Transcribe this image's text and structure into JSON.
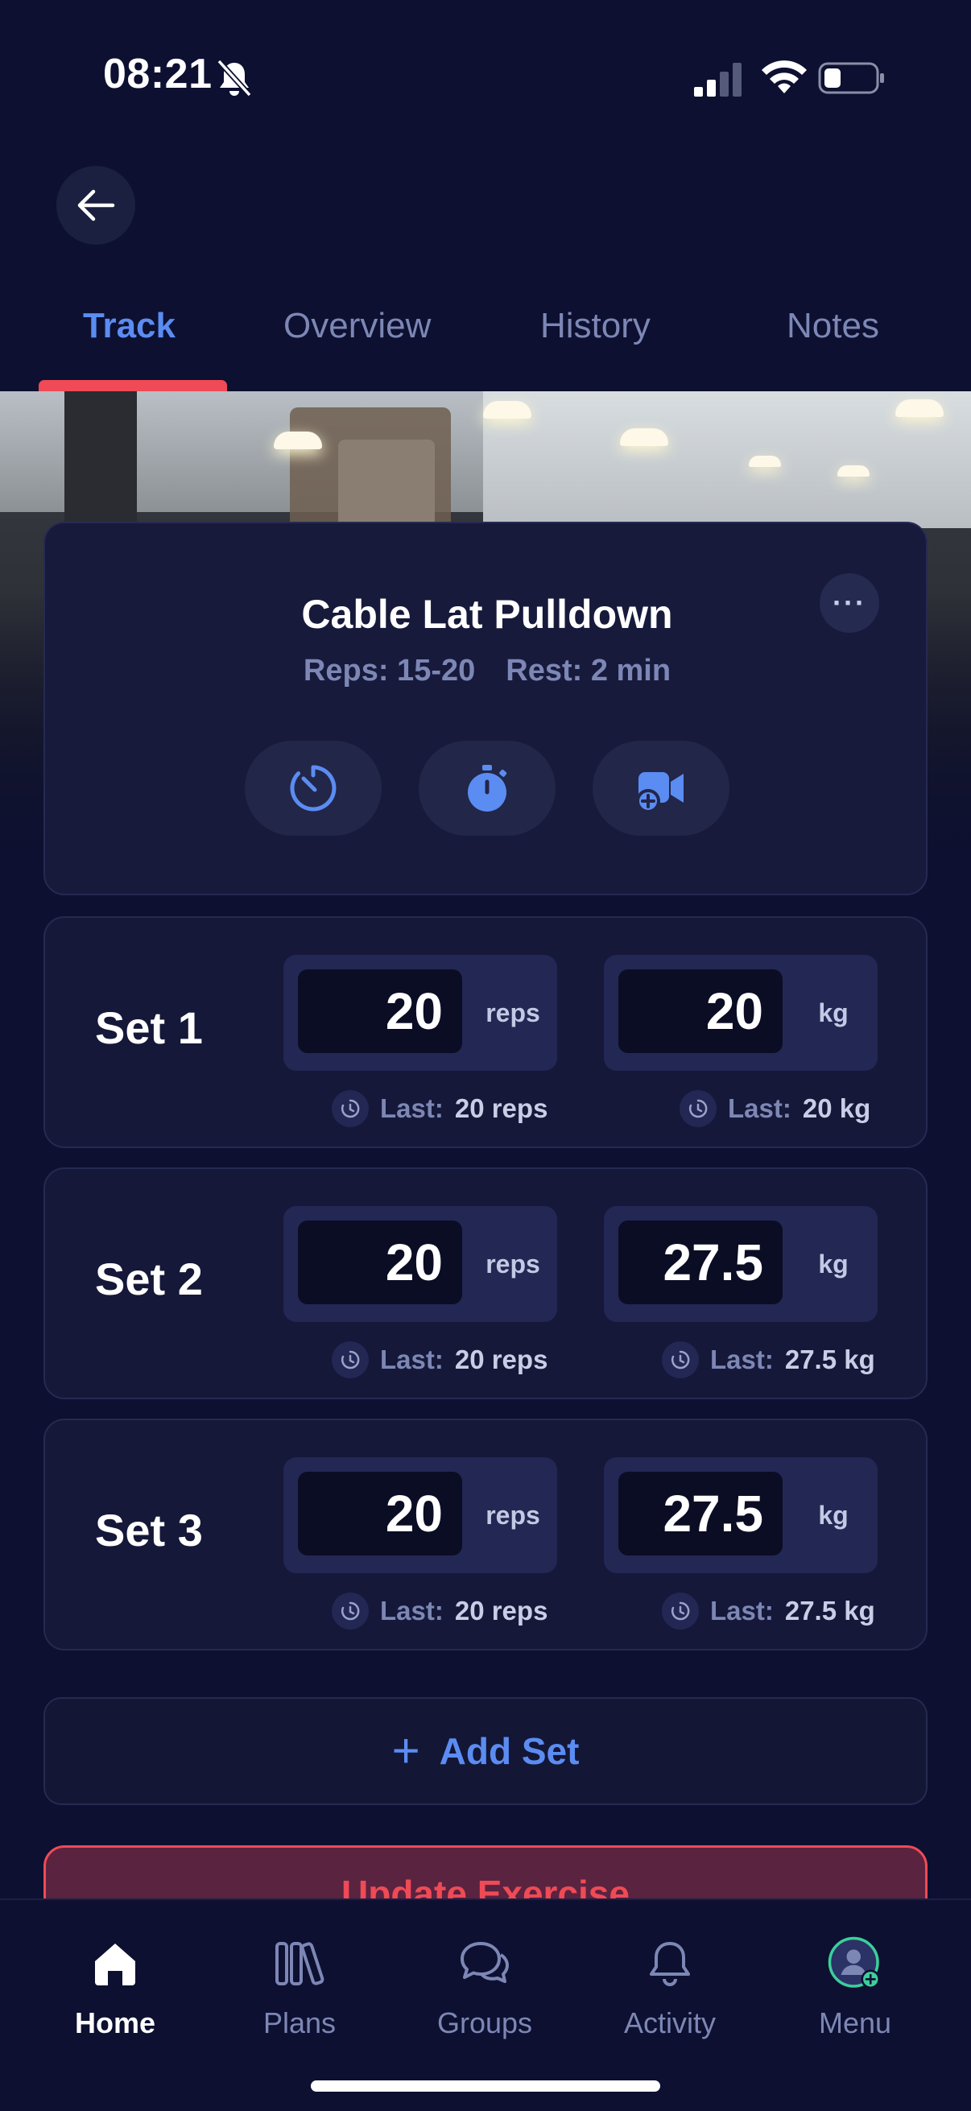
{
  "status_bar": {
    "time": "08:21"
  },
  "tabs": [
    {
      "label": "Track",
      "active": true
    },
    {
      "label": "Overview",
      "active": false
    },
    {
      "label": "History",
      "active": false
    },
    {
      "label": "Notes",
      "active": false
    }
  ],
  "exercise": {
    "title": "Cable Lat Pulldown",
    "reps": "Reps: 15-20",
    "rest": "Rest: 2 min",
    "actions": [
      "timer-icon",
      "stopwatch-icon",
      "add-video-icon"
    ]
  },
  "sets": [
    {
      "label": "Set 1",
      "reps": "20",
      "reps_unit": "reps",
      "weight": "20",
      "weight_unit": "kg",
      "last_label": "Last:",
      "last_reps": "20 reps",
      "last_weight": "20 kg"
    },
    {
      "label": "Set 2",
      "reps": "20",
      "reps_unit": "reps",
      "weight": "27.5",
      "weight_unit": "kg",
      "last_label": "Last:",
      "last_reps": "20 reps",
      "last_weight": "27.5 kg"
    },
    {
      "label": "Set 3",
      "reps": "20",
      "reps_unit": "reps",
      "weight": "27.5",
      "weight_unit": "kg",
      "last_label": "Last:",
      "last_reps": "20 reps",
      "last_weight": "27.5 kg"
    }
  ],
  "add_set_label": "Add Set",
  "update_label": "Update Exercise",
  "nav": [
    {
      "label": "Home",
      "icon": "home-icon",
      "active": true
    },
    {
      "label": "Plans",
      "icon": "plans-icon",
      "active": false
    },
    {
      "label": "Groups",
      "icon": "groups-icon",
      "active": false
    },
    {
      "label": "Activity",
      "icon": "bell-icon",
      "active": false
    },
    {
      "label": "Menu",
      "icon": "avatar-icon",
      "active": false
    }
  ],
  "colors": {
    "background": "#0d1030",
    "accent": "#5b8cf2",
    "danger": "#ef4a55",
    "muted": "#7d87b5"
  }
}
